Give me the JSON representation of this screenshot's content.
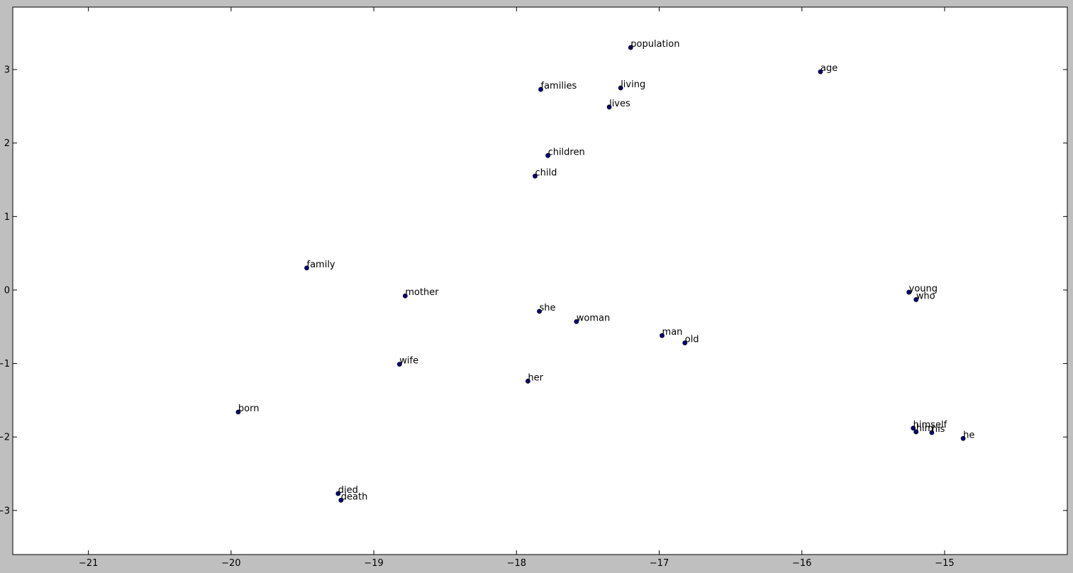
{
  "chart_data": {
    "type": "scatter",
    "title": "",
    "xlabel": "",
    "ylabel": "",
    "xlim": [
      -21.53,
      -18.15
    ],
    "ylim": [
      -3.6,
      3.85
    ],
    "grid": false,
    "point_color": "#000080",
    "figure_background": "#bfbfbf",
    "axes_background": "#ffffff",
    "x_ticks": [
      {
        "value": -21,
        "label": "−21"
      },
      {
        "value": -20,
        "label": "−20"
      },
      {
        "value": -19,
        "label": "−19"
      },
      {
        "value": -18,
        "label": "−18"
      },
      {
        "value": -17,
        "label": "−17"
      },
      {
        "value": -16,
        "label": "−16"
      },
      {
        "value": -15,
        "label": "−15"
      }
    ],
    "y_ticks": [
      {
        "value": 3,
        "label": "3"
      },
      {
        "value": 2,
        "label": "2"
      },
      {
        "value": 1,
        "label": "1"
      },
      {
        "value": 0,
        "label": "0"
      },
      {
        "value": -1,
        "label": "−1"
      },
      {
        "value": -2,
        "label": "−2"
      },
      {
        "value": -3,
        "label": "−3"
      }
    ],
    "points": [
      {
        "label": "population",
        "x": -17.2,
        "y": 3.3
      },
      {
        "label": "age",
        "x": -15.87,
        "y": 2.97
      },
      {
        "label": "families",
        "x": -17.83,
        "y": 2.73
      },
      {
        "label": "living",
        "x": -17.27,
        "y": 2.75
      },
      {
        "label": "lives",
        "x": -17.35,
        "y": 2.49
      },
      {
        "label": "children",
        "x": -17.78,
        "y": 1.83
      },
      {
        "label": "child",
        "x": -17.87,
        "y": 1.55
      },
      {
        "label": "family",
        "x": -19.47,
        "y": 0.3
      },
      {
        "label": "mother",
        "x": -18.78,
        "y": -0.08
      },
      {
        "label": "she",
        "x": -17.84,
        "y": -0.29
      },
      {
        "label": "woman",
        "x": -17.58,
        "y": -0.43
      },
      {
        "label": "man",
        "x": -16.98,
        "y": -0.62
      },
      {
        "label": "old",
        "x": -16.82,
        "y": -0.72
      },
      {
        "label": "young",
        "x": -15.25,
        "y": -0.03
      },
      {
        "label": "who",
        "x": -15.2,
        "y": -0.13
      },
      {
        "label": "wife",
        "x": -18.82,
        "y": -1.01
      },
      {
        "label": "her",
        "x": -17.92,
        "y": -1.24
      },
      {
        "label": "born",
        "x": -19.95,
        "y": -1.66
      },
      {
        "label": "himself",
        "x": -15.22,
        "y": -1.88
      },
      {
        "label": "him",
        "x": -15.2,
        "y": -1.93
      },
      {
        "label": "his",
        "x": -15.09,
        "y": -1.94
      },
      {
        "label": "he",
        "x": -14.87,
        "y": -2.02
      },
      {
        "label": "died",
        "x": -19.25,
        "y": -2.77
      },
      {
        "label": "death",
        "x": -19.23,
        "y": -2.86
      }
    ]
  }
}
